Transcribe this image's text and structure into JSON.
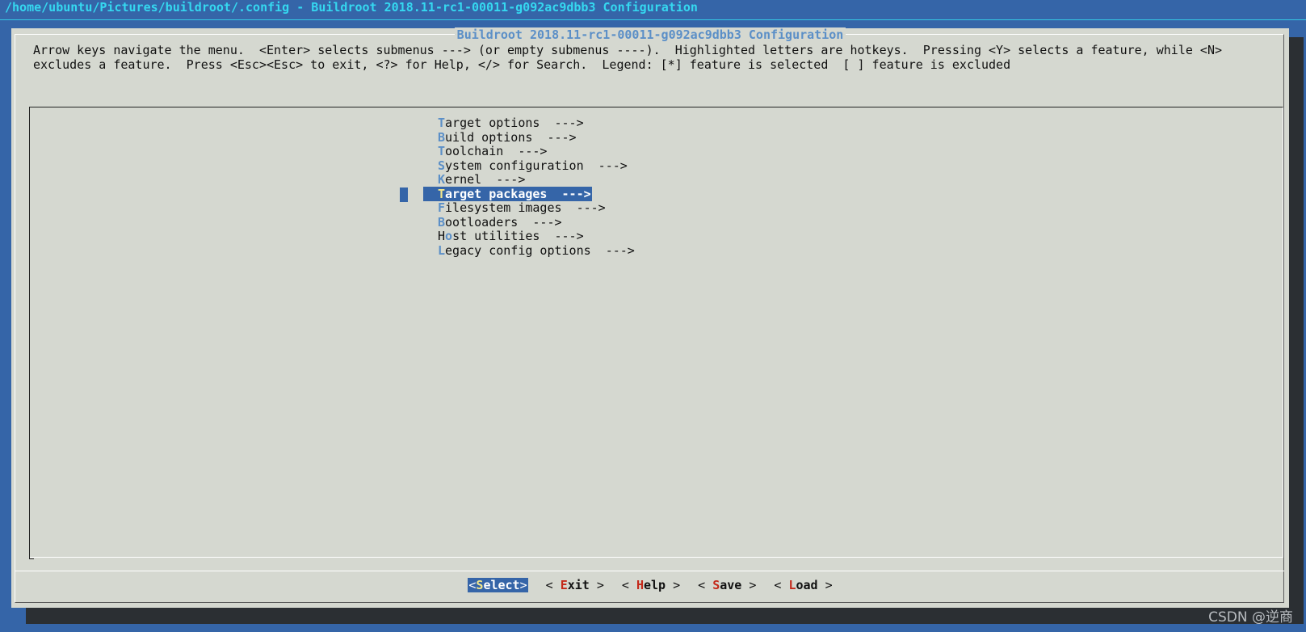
{
  "window": {
    "title": "/home/ubuntu/Pictures/buildroot/.config - Buildroot 2018.11-rc1-00011-g092ac9dbb3 Configuration"
  },
  "dialog": {
    "title": "Buildroot 2018.11-rc1-00011-g092ac9dbb3 Configuration",
    "help_line1": "Arrow keys navigate the menu.  <Enter> selects submenus ---> (or empty submenus ----).  Highlighted letters are hotkeys.  Pressing <Y> selects a feature, while <N>",
    "help_line2": "excludes a feature.  Press <Esc><Esc> to exit, <?> for Help, </> for Search.  Legend: [*] feature is selected  [ ] feature is excluded"
  },
  "menu": {
    "selected_index": 5,
    "items": [
      {
        "pre": "",
        "hotkey": "T",
        "rest": "arget options  --->"
      },
      {
        "pre": "",
        "hotkey": "B",
        "rest": "uild options  --->"
      },
      {
        "pre": "",
        "hotkey": "T",
        "rest": "oolchain  --->"
      },
      {
        "pre": "",
        "hotkey": "S",
        "rest": "ystem configuration  --->"
      },
      {
        "pre": "",
        "hotkey": "K",
        "rest": "ernel  --->"
      },
      {
        "pre": "",
        "hotkey": "T",
        "rest": "arget packages  --->"
      },
      {
        "pre": "",
        "hotkey": "F",
        "rest": "ilesystem images  --->"
      },
      {
        "pre": "",
        "hotkey": "B",
        "rest": "ootloaders  --->"
      },
      {
        "pre": "H",
        "hotkey": "o",
        "rest": "st utilities  --->"
      },
      {
        "pre": "",
        "hotkey": "L",
        "rest": "egacy config options  --->"
      }
    ]
  },
  "buttons": [
    {
      "left": "<",
      "hotkey": "S",
      "rest": "elect",
      "right": ">",
      "active": true
    },
    {
      "left": "< ",
      "hotkey": "E",
      "rest": "xit",
      "right": " >",
      "active": false
    },
    {
      "left": "< ",
      "hotkey": "H",
      "rest": "elp",
      "right": " >",
      "active": false
    },
    {
      "left": "< ",
      "hotkey": "S",
      "rest": "ave",
      "right": " >",
      "active": false
    },
    {
      "left": "< ",
      "hotkey": "L",
      "rest": "oad",
      "right": " >",
      "active": false
    }
  ],
  "watermark": "CSDN @逆商",
  "colors": {
    "background": "#3565a8",
    "dialog": "#d5d8d0",
    "title_text": "#35d8f0",
    "hotkey": "#5b8fc7",
    "button_hotkey": "#c4291a",
    "selected_hotkey": "#f2e78c"
  }
}
